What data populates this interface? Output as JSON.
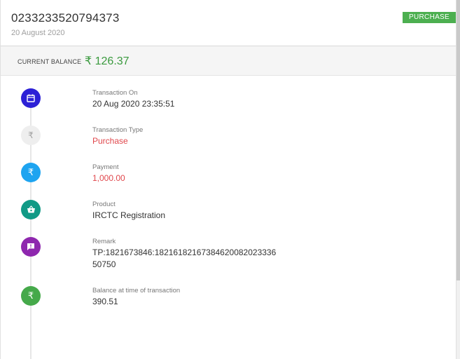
{
  "header": {
    "transaction_id": "0233233520794373",
    "date": "20 August 2020",
    "badge": "PURCHASE"
  },
  "balance": {
    "label": "CURRENT BALANCE",
    "value": "₹ 126.37"
  },
  "details": [
    {
      "icon": "calendar-icon",
      "color": "#2d21d6",
      "label": "Transaction On",
      "value": "20 Aug 2020 23:35:51"
    },
    {
      "icon": "rupee-icon",
      "color": "#eeeeee",
      "label": "Transaction Type",
      "value": "Purchase"
    },
    {
      "icon": "rupee-icon",
      "color": "#1ea4f0",
      "label": "Payment",
      "value": "1,000.00"
    },
    {
      "icon": "basket-icon",
      "color": "#119a86",
      "label": "Product",
      "value": "IRCTC Registration"
    },
    {
      "icon": "comment-alert-icon",
      "color": "#8e27ae",
      "label": "Remark",
      "value_line1": "TP:1821673846:18216182167384620082023336",
      "value_line2": "50750"
    },
    {
      "icon": "rupee-icon",
      "color": "#45a94a",
      "label": "Balance at time of transaction",
      "value": "390.51"
    }
  ],
  "colors": {
    "accent_green": "#4caf50",
    "balance_green": "#3a9a3e",
    "red_value": "#e0474c"
  }
}
